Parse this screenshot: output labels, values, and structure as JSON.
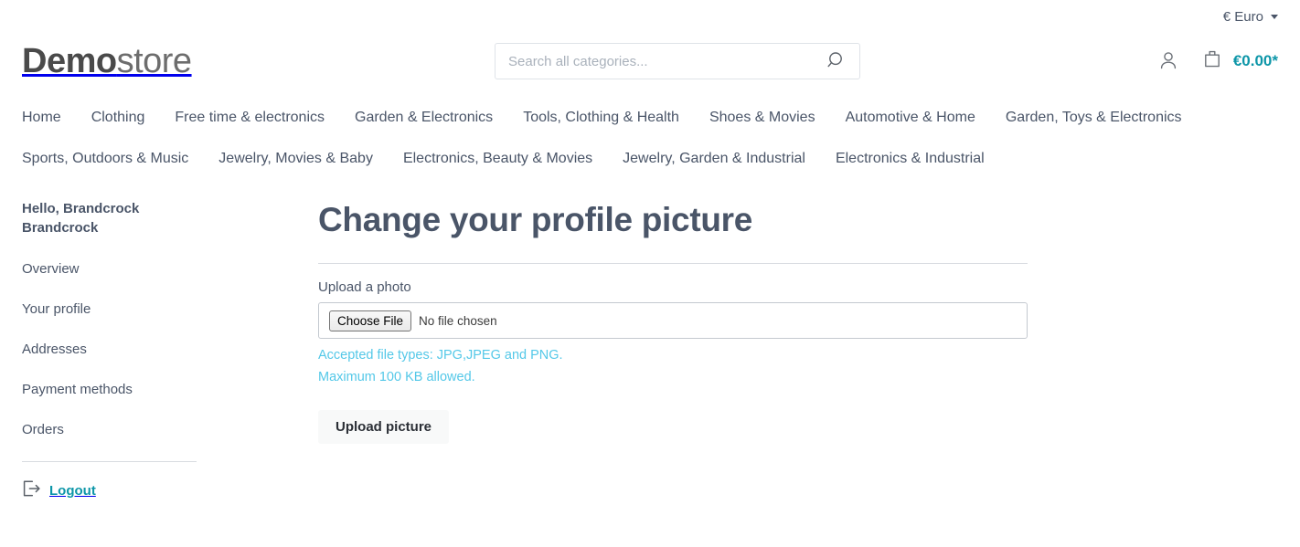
{
  "topbar": {
    "currency_label": "€ Euro",
    "currency_caret": "chevron-down-icon"
  },
  "header": {
    "logo_bold": "Demo",
    "logo_light": "store",
    "search_placeholder": "Search all categories...",
    "search_value": "",
    "search_icon": "search-icon",
    "account_icon": "person-icon",
    "cart_icon": "shopping-bag-icon",
    "cart_total": "€0.00*"
  },
  "nav": {
    "items": [
      {
        "label": "Home"
      },
      {
        "label": "Clothing"
      },
      {
        "label": "Free time & electronics"
      },
      {
        "label": "Garden & Electronics"
      },
      {
        "label": "Tools, Clothing & Health"
      },
      {
        "label": "Shoes & Movies"
      },
      {
        "label": "Automotive & Home"
      },
      {
        "label": "Garden, Toys & Electronics"
      },
      {
        "label": "Sports, Outdoors & Music"
      },
      {
        "label": "Jewelry, Movies & Baby"
      },
      {
        "label": "Electronics, Beauty & Movies"
      },
      {
        "label": "Jewelry, Garden & Industrial"
      },
      {
        "label": "Electronics & Industrial"
      }
    ]
  },
  "sidebar": {
    "greeting": "Hello, Brandcrock Brandcrock",
    "items": [
      {
        "label": "Overview"
      },
      {
        "label": "Your profile"
      },
      {
        "label": "Addresses"
      },
      {
        "label": "Payment methods"
      },
      {
        "label": "Orders"
      }
    ],
    "logout_label": "Logout",
    "logout_icon": "logout-icon"
  },
  "main": {
    "title": "Change your profile picture",
    "upload_label": "Upload a photo",
    "file_button_label": "Choose File",
    "file_status": "No file chosen",
    "hint_types": "Accepted file types: JPG,JPEG and PNG.",
    "hint_size": "Maximum 100 KB allowed.",
    "submit_label": "Upload picture"
  },
  "colors": {
    "accent_teal": "#0d96a8",
    "hint_blue": "#54c8e8",
    "text": "#4a5568",
    "border": "#d8dbe0"
  }
}
